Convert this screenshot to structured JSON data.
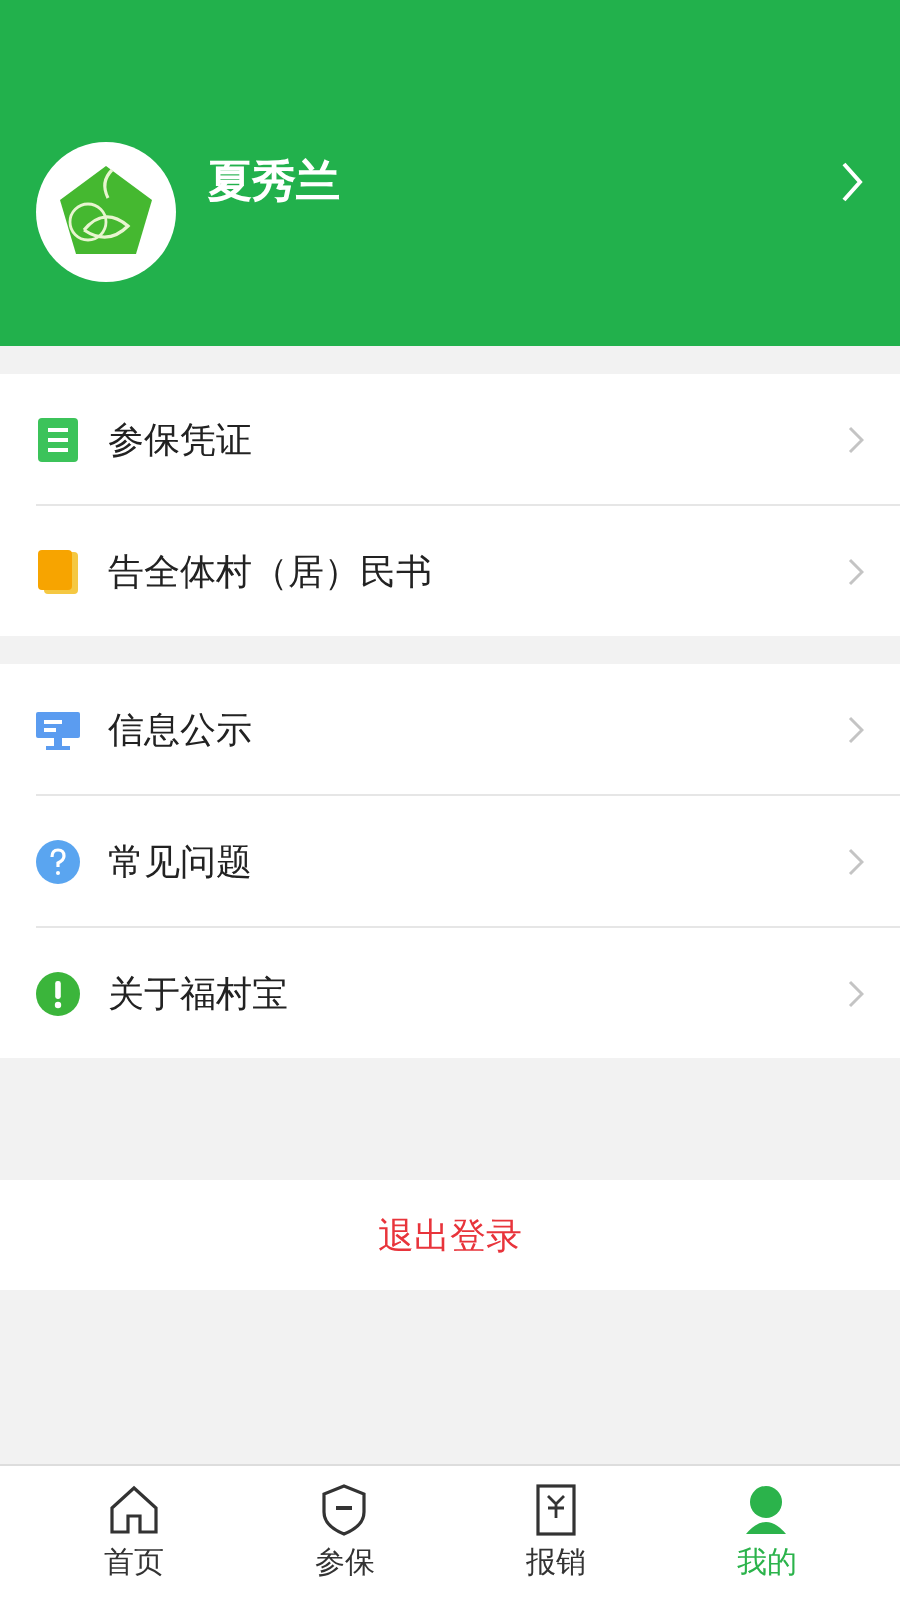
{
  "profile": {
    "name": "夏秀兰"
  },
  "menu_groups": [
    {
      "items": [
        {
          "kind": "document",
          "label": "参保凭证"
        },
        {
          "kind": "book",
          "label": "告全体村（居）民书"
        }
      ]
    },
    {
      "items": [
        {
          "kind": "board",
          "label": "信息公示"
        },
        {
          "kind": "question",
          "label": "常见问题"
        },
        {
          "kind": "info",
          "label": "关于福村宝"
        }
      ]
    }
  ],
  "logout": "退出登录",
  "tab_bar": [
    {
      "kind": "home",
      "label": "首页",
      "selected": false
    },
    {
      "kind": "shield",
      "label": "参保",
      "selected": false
    },
    {
      "kind": "receipt",
      "label": "报销",
      "selected": false
    },
    {
      "kind": "person",
      "label": "我的",
      "selected": true
    }
  ]
}
